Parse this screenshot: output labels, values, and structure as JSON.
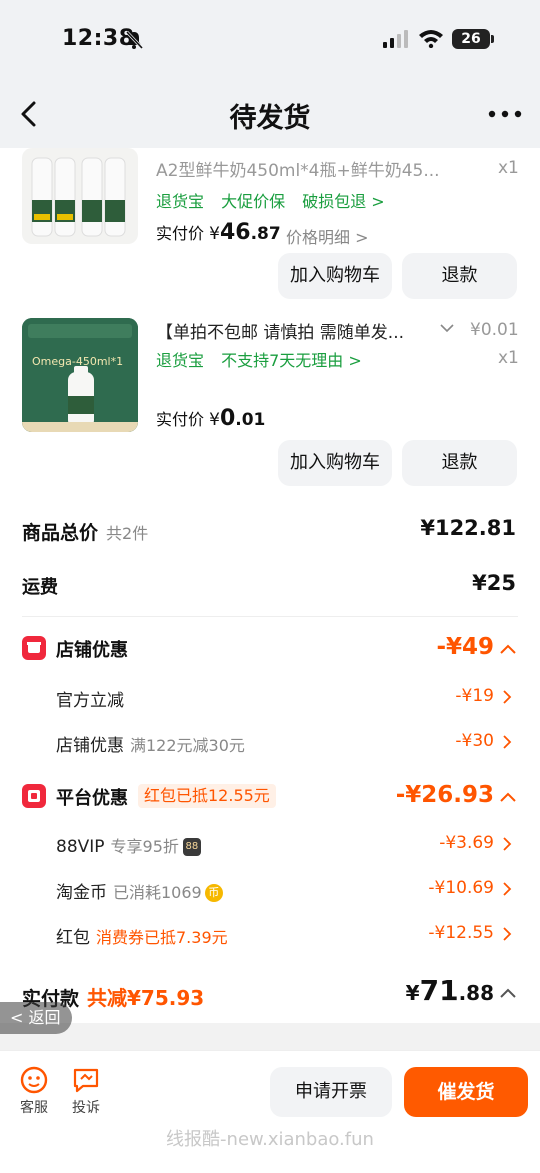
{
  "status_bar": {
    "time": "12:38",
    "battery": "26"
  },
  "header": {
    "title": "待发货"
  },
  "products": [
    {
      "title": "A2型鲜牛奶450ml*4瓶+鲜牛奶45...",
      "qty": "x1",
      "tags": [
        "退货宝",
        "大促价保",
        "破损包退 >"
      ],
      "paid_label": "实付价",
      "paid_yen": "¥",
      "paid_int": "46",
      "paid_dec": ".87",
      "price_detail": "价格明细 >",
      "add_cart": "加入购物车",
      "refund": "退款"
    },
    {
      "title": "【单拍不包邮 请慎拍 需随单发...",
      "price": "¥0.01",
      "qty": "x1",
      "tags": [
        "退货宝",
        "不支持7天无理由 >"
      ],
      "paid_label": "实付价",
      "paid_yen": "¥",
      "paid_int": "0",
      "paid_dec": ".01",
      "add_cart": "加入购物车",
      "refund": "退款",
      "image_text": "Omega-450ml*1"
    }
  ],
  "summary": {
    "goods_total_label": "商品总价",
    "goods_count": "共2件",
    "goods_total": "¥122.81",
    "shipping_label": "运费",
    "shipping": "¥25"
  },
  "store_discount": {
    "label": "店铺优惠",
    "value": "-¥49",
    "items": [
      {
        "label": "官方立减",
        "note": "",
        "value": "-¥19"
      },
      {
        "label": "店铺优惠",
        "note": "满122元减30元",
        "value": "-¥30"
      }
    ]
  },
  "platform_discount": {
    "label": "平台优惠",
    "tag": "红包已抵12.55元",
    "value": "-¥26.93",
    "items": [
      {
        "label": "88VIP",
        "note": "专享95折",
        "badge": "88",
        "value": "-¥3.69"
      },
      {
        "label": "淘金币",
        "note": "已消耗1069",
        "badge": "币",
        "value": "-¥10.69"
      },
      {
        "label": "红包",
        "note": "消费券已抵7.39元",
        "value": "-¥12.55"
      }
    ]
  },
  "total": {
    "label": "实付款",
    "saved": "共减¥75.93",
    "yen": "¥",
    "int": "71",
    "dec": ".88"
  },
  "return_pill": "< 返回",
  "bottom_bar": {
    "service": "客服",
    "complaint": "投诉",
    "invoice": "申请开票",
    "urge": "催发货",
    "watermark": "线报酷-new.xianbao.fun"
  },
  "colors": {
    "accent": "#ff5500",
    "green": "#1a9e3f",
    "red_badge": "#f0283c"
  }
}
